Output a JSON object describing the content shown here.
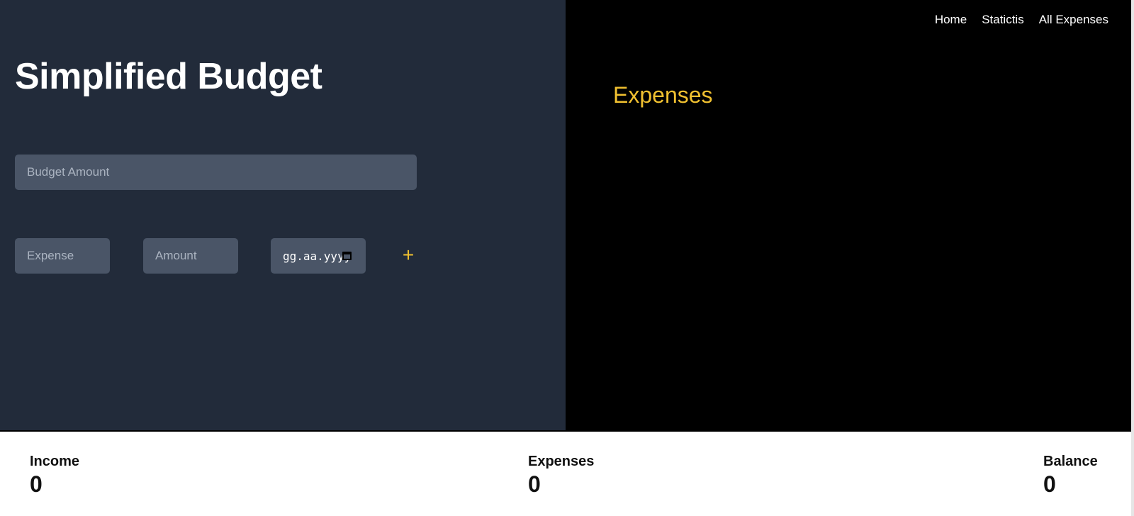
{
  "app": {
    "title": "Simplified Budget"
  },
  "nav": {
    "items": [
      "Home",
      "Statictis",
      "All Expenses"
    ]
  },
  "form": {
    "budget_placeholder": "Budget Amount",
    "expense_placeholder": "Expense",
    "amount_placeholder": "Amount",
    "date_placeholder": "gg.aa.yyyy",
    "add_icon": "plus-icon",
    "calendar_icon": "calendar-icon"
  },
  "expenses_panel": {
    "heading": "Expenses"
  },
  "summary": {
    "income_label": "Income",
    "income_value": "0",
    "expenses_label": "Expenses",
    "expenses_value": "0",
    "balance_label": "Balance",
    "balance_value": "0"
  },
  "colors": {
    "accent": "#f0c030",
    "left_bg": "#222b3a",
    "right_bg": "#000000",
    "field_bg": "#4a5567"
  }
}
